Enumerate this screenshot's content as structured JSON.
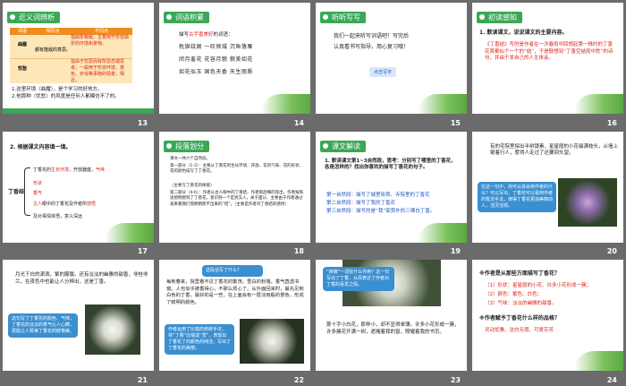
{
  "slides": [
    {
      "num": "13",
      "title": "近义词辨析",
      "table_header": [
        "词语",
        "相同点",
        "不同点"
      ],
      "rows": [
        [
          "曲履",
          "都有隆敌的意思。",
          "指曲折蜿蜒，主要用于形容曲折的环境和景物。"
        ],
        [
          "忧愁",
          "",
          "指由于忧思而有所思念或思考。一般用于形容环境、景色、步伐等事物的情景，相近。"
        ]
      ],
      "fill": [
        "1.这里环境（曲履），是个学习的好地方。",
        "2.他那种（忧愁）的风度是任何人都模仿不了的。"
      ]
    },
    {
      "num": "14",
      "title": "词语积累",
      "intro": "描写",
      "intro_red": "古手香美好",
      "intro_end": "的词语：",
      "words": [
        "枕旗绕阁 一叹倾城 沉鱼落雁",
        "闭月羞花 花容月貌 貌美如花",
        "如花似玉 国色天香 天生丽质"
      ]
    },
    {
      "num": "15",
      "title": "听听写写",
      "line1": "我们一起来听写词语吧！写完后",
      "line2": "认真看书写指导，用心复习哦！",
      "btn": "点击写字"
    },
    {
      "num": "16",
      "title": "初读感知",
      "q": "1. 默读课文，说说课文的主要内容。",
      "a": "《丁香结》写的是作者在一次春雨中回想起第一株时的丁香花首都似个一个的“结”，于是联想到“丁香空结雨中愁”的诗句，并由于发自己的人生体会。"
    },
    {
      "num": "17",
      "q": "2. 根据课文内容填一填。",
      "brace": "丁香结",
      "items": [
        "丁香花的",
        "生长环境",
        "，开放器盛，",
        "气味",
        "形状",
        "香气",
        "古人",
        "眼中的丁香花及作者所",
        "感悟",
        "及对事情体悟，意义深远"
      ]
    },
    {
      "num": "18",
      "title": "段落划分",
      "lines": [
        "课文一共六个自然段。",
        "第一部分（1-3）：主要从丁香花的生长环境、开放、花的气味、花的形状、花的颜色描写了丁香花。",
        "（主要写了香花的样貌）",
        "第二部分（4-6）：作者从古人眼中的丁香结、作者雨后细的现出，作者按照思想明想到了丁香花，意识到一个是另又人，关于面认、主要由于作者通过发来看我们而明明而不出来的“结”。（主要是作者对丁香结的感悟）"
      ]
    },
    {
      "num": "19",
      "title": "课文解读",
      "q": "1. 默读课文第1~3自然段，思考：分别写了哪里的丁香花，各是怎样的？找出你喜欢的描写丁香花的句子。",
      "items": [
        "第一自然段：描写了城里街旁、寺院里的丁香花",
        "第二自然段：描写了我的丁香花",
        "第三自然段：描写的是“我”家旁外的三棵白丁香。"
      ]
    },
    {
      "num": "20",
      "p": "有的宅院里探出半树银素，星星般的小花缀满枝头，从墙上窥着行人，惹得人走过了还要回头望。",
      "bubble": "在这一句中，你可以体会到作者的什么？可以写出，丁香花可以看到作者的笔法手法，使得丁香花更加美丽动人，活灵活现。"
    },
    {
      "num": "21",
      "p": "月光下白的潇洒，紫的朦胧。还有淡淡的幽雅的甜香，非桂非兰，在夜色中也能让人分辨出，这是丁香。",
      "bubble": "这句写了丁香花的颜色、气味，丁香花的淡淡的香气沁人心脾，更能让人赞美丁香花的鲜艳美。"
    },
    {
      "num": "22",
      "bubble1": "这段话写了什么？",
      "p": "每到春来，院里看不见丁香花的繁茂，雪白的粉墙，香气直透书窗。人也似乎被香得心，不那么烦心了。从外面回来时，最先见到白色的丁香，最好的是一些，在上面会有一层淡雨般的景色，形成了鲜明的颜色。",
      "bubble2": "作者运用了比喻的修辞手法，将“丁香”比喻成“雪”，表现出丁香花了的颜色的纯洁，写出了丁香花的美丽。"
    },
    {
      "num": "23",
      "bubble": "“娇嫩”一词有什么作用？这一句写出了丁香，从而表达了作者对丁香的喜爱之情。",
      "p": "那十字小白花，那样小，却不显得单薄。许多小花形成一簇，许多簇花开满一树，遮掩着我的窗，照耀着我的书页。"
    },
    {
      "num": "24",
      "q1": "※作者是从那些方面描写丁香花？",
      "list": [
        "（1）形状：星星般的小花、许多小花形成一簇；",
        "（2）颜色：紫色、白色；",
        "（3）气味：淡淡的幽雅的甜香。"
      ],
      "q2": "※作者赋予丁香花什么样的品格？",
      "answer": "灵动优雅、洁白无瑕、可爱芬芳"
    }
  ],
  "colors": {
    "green": "#3aa856",
    "red": "#d9261c",
    "blue": "#2457c5",
    "bubble": "#3a8fd0",
    "bg": "#6b6b6b",
    "orange": "#f08c1e"
  }
}
